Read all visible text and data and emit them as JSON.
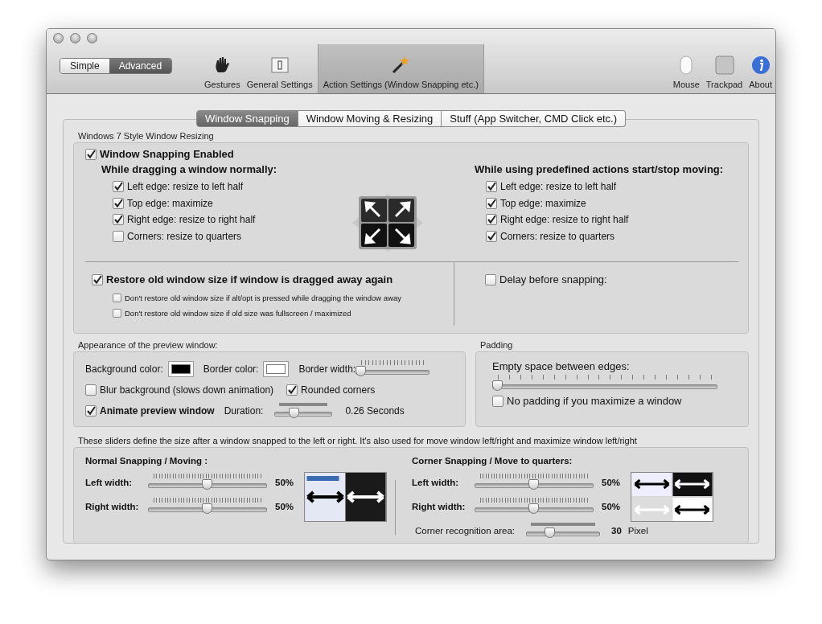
{
  "mode_toggle": [
    {
      "label": "Simple",
      "selected": false
    },
    {
      "label": "Advanced",
      "selected": true
    }
  ],
  "toolbar": [
    {
      "kind": "gestures",
      "label": "Gestures",
      "selected": false
    },
    {
      "kind": "general",
      "label": "General Settings",
      "selected": false
    },
    {
      "kind": "action",
      "label": "Action Settings (Window Snapping etc.)",
      "selected": true
    },
    {
      "kind": "spacer"
    },
    {
      "kind": "mouse",
      "label": "Mouse",
      "selected": false
    },
    {
      "kind": "trackpad",
      "label": "Trackpad",
      "selected": false
    },
    {
      "kind": "about",
      "label": "About",
      "selected": false
    }
  ],
  "tabs": [
    {
      "label": "Window Snapping",
      "selected": true
    },
    {
      "label": "Window Moving & Resizing",
      "selected": false
    },
    {
      "label": "Stuff (App Switcher, CMD Click etc.)",
      "selected": false
    }
  ],
  "snapping": {
    "title": "Windows 7 Style Window Resizing",
    "enabled": {
      "label": "Window Snapping Enabled",
      "checked": true
    },
    "dragging": {
      "heading": "While dragging a window normally:",
      "options": [
        {
          "label": "Left edge: resize to left half",
          "checked": true
        },
        {
          "label": "Top edge: maximize",
          "checked": true
        },
        {
          "label": "Right edge: resize to right half",
          "checked": true
        },
        {
          "label": "Corners: resize to quarters",
          "checked": false
        }
      ]
    },
    "predefined": {
      "heading": "While using predefined actions start/stop moving:",
      "options": [
        {
          "label": "Left edge: resize to left half",
          "checked": true
        },
        {
          "label": "Top edge: maximize",
          "checked": true
        },
        {
          "label": "Right edge: resize to right half",
          "checked": true
        },
        {
          "label": "Corners: resize to quarters",
          "checked": true
        }
      ]
    },
    "restore": {
      "label": "Restore old window size if window is dragged away again",
      "checked": true,
      "options": [
        {
          "label": "Don't restore old window size if alt/opt is pressed while dragging the window away",
          "checked": false
        },
        {
          "label": "Don't restore old window size if old size was fullscreen / maximized",
          "checked": false
        }
      ]
    },
    "delay": {
      "label": "Delay before snapping:",
      "checked": false
    }
  },
  "appearance": {
    "title": "Appearance of the preview window:",
    "background_color": {
      "label": "Background color:",
      "color": "#000000"
    },
    "border_color": {
      "label": "Border color:",
      "color": "#ffffff"
    },
    "border_width": {
      "label": "Border width:",
      "level": 0.0
    },
    "blur": {
      "label": "Blur background (slows down animation)",
      "checked": false
    },
    "rounded": {
      "label": "Rounded corners",
      "checked": true
    },
    "animate": {
      "label": "Animate preview window",
      "checked": true
    },
    "duration": {
      "label": "Duration:",
      "level": 0.3,
      "reading": "0.26 Seconds"
    }
  },
  "padding": {
    "title": "Padding",
    "label": "Empty space between edges:",
    "level": 0.0,
    "no_padding": {
      "label": "No padding if you maximize a window",
      "checked": false
    }
  },
  "sizes": {
    "note": "These sliders define the size after a window snapped to the left or right. It's also used for move window left/right and maximize window left/right",
    "normal": {
      "heading": "Normal Snapping  /  Moving :",
      "rows": [
        {
          "label": "Left width:",
          "level": 0.5,
          "reading": "50%"
        },
        {
          "label": "Right width:",
          "level": 0.5,
          "reading": "50%"
        }
      ]
    },
    "corner": {
      "heading": "Corner Snapping  /  Move to quarters:",
      "rows": [
        {
          "label": "Left width:",
          "level": 0.5,
          "reading": "50%"
        },
        {
          "label": "Right width:",
          "level": 0.5,
          "reading": "50%"
        }
      ],
      "recognition": {
        "label": "Corner recognition area:",
        "level": 0.3,
        "reading": "30",
        "unit": "Pixel"
      }
    }
  }
}
